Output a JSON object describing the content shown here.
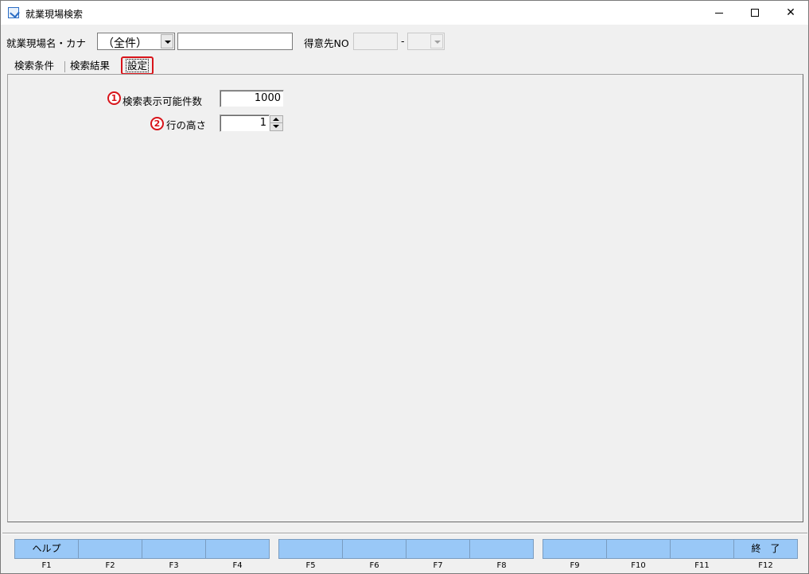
{
  "window": {
    "title": "就業現場検索",
    "minimize_glyph": "",
    "close_glyph": "✕"
  },
  "search_bar": {
    "site_label": "就業現場名・カナ",
    "kana_filter_value": "（全件）",
    "site_name_value": "",
    "customer_label": "得意先NO",
    "customer_no_value": "",
    "dash": "-",
    "customer_branch_value": ""
  },
  "tabs": [
    {
      "label": "検索条件",
      "active": false
    },
    {
      "label": "検索結果",
      "active": false
    },
    {
      "label": "設定",
      "active": true
    }
  ],
  "settings": {
    "max_results_badge": "1",
    "max_results_label": "検索表示可能件数",
    "max_results_value": "1000",
    "row_height_badge": "2",
    "row_height_label": "行の高さ",
    "row_height_value": "1"
  },
  "function_keys": [
    {
      "label": "ヘルプ",
      "key": "F1"
    },
    {
      "label": "",
      "key": "F2"
    },
    {
      "label": "",
      "key": "F3"
    },
    {
      "label": "",
      "key": "F4"
    },
    {
      "label": "",
      "key": "F5"
    },
    {
      "label": "",
      "key": "F6"
    },
    {
      "label": "",
      "key": "F7"
    },
    {
      "label": "",
      "key": "F8"
    },
    {
      "label": "",
      "key": "F9"
    },
    {
      "label": "",
      "key": "F10"
    },
    {
      "label": "",
      "key": "F11"
    },
    {
      "label": "終　了",
      "key": "F12"
    }
  ],
  "colors": {
    "function_key_bg": "#99c8f7",
    "annotation_red": "#d8141a"
  }
}
